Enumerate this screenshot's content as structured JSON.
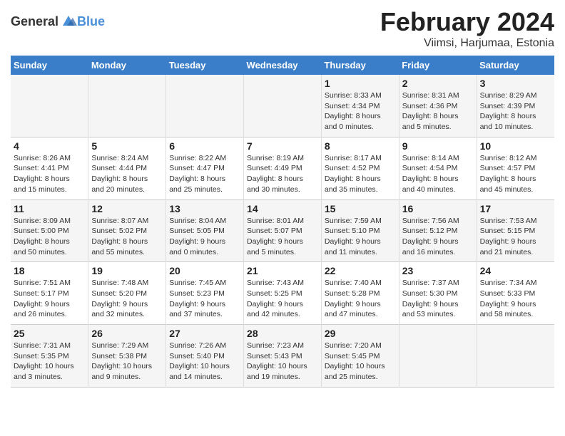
{
  "header": {
    "logo_general": "General",
    "logo_blue": "Blue",
    "title": "February 2024",
    "subtitle": "Viimsi, Harjumaa, Estonia"
  },
  "columns": [
    "Sunday",
    "Monday",
    "Tuesday",
    "Wednesday",
    "Thursday",
    "Friday",
    "Saturday"
  ],
  "weeks": [
    {
      "days": [
        {
          "num": "",
          "info": ""
        },
        {
          "num": "",
          "info": ""
        },
        {
          "num": "",
          "info": ""
        },
        {
          "num": "",
          "info": ""
        },
        {
          "num": "1",
          "info": "Sunrise: 8:33 AM\nSunset: 4:34 PM\nDaylight: 8 hours\nand 0 minutes."
        },
        {
          "num": "2",
          "info": "Sunrise: 8:31 AM\nSunset: 4:36 PM\nDaylight: 8 hours\nand 5 minutes."
        },
        {
          "num": "3",
          "info": "Sunrise: 8:29 AM\nSunset: 4:39 PM\nDaylight: 8 hours\nand 10 minutes."
        }
      ]
    },
    {
      "days": [
        {
          "num": "4",
          "info": "Sunrise: 8:26 AM\nSunset: 4:41 PM\nDaylight: 8 hours\nand 15 minutes."
        },
        {
          "num": "5",
          "info": "Sunrise: 8:24 AM\nSunset: 4:44 PM\nDaylight: 8 hours\nand 20 minutes."
        },
        {
          "num": "6",
          "info": "Sunrise: 8:22 AM\nSunset: 4:47 PM\nDaylight: 8 hours\nand 25 minutes."
        },
        {
          "num": "7",
          "info": "Sunrise: 8:19 AM\nSunset: 4:49 PM\nDaylight: 8 hours\nand 30 minutes."
        },
        {
          "num": "8",
          "info": "Sunrise: 8:17 AM\nSunset: 4:52 PM\nDaylight: 8 hours\nand 35 minutes."
        },
        {
          "num": "9",
          "info": "Sunrise: 8:14 AM\nSunset: 4:54 PM\nDaylight: 8 hours\nand 40 minutes."
        },
        {
          "num": "10",
          "info": "Sunrise: 8:12 AM\nSunset: 4:57 PM\nDaylight: 8 hours\nand 45 minutes."
        }
      ]
    },
    {
      "days": [
        {
          "num": "11",
          "info": "Sunrise: 8:09 AM\nSunset: 5:00 PM\nDaylight: 8 hours\nand 50 minutes."
        },
        {
          "num": "12",
          "info": "Sunrise: 8:07 AM\nSunset: 5:02 PM\nDaylight: 8 hours\nand 55 minutes."
        },
        {
          "num": "13",
          "info": "Sunrise: 8:04 AM\nSunset: 5:05 PM\nDaylight: 9 hours\nand 0 minutes."
        },
        {
          "num": "14",
          "info": "Sunrise: 8:01 AM\nSunset: 5:07 PM\nDaylight: 9 hours\nand 5 minutes."
        },
        {
          "num": "15",
          "info": "Sunrise: 7:59 AM\nSunset: 5:10 PM\nDaylight: 9 hours\nand 11 minutes."
        },
        {
          "num": "16",
          "info": "Sunrise: 7:56 AM\nSunset: 5:12 PM\nDaylight: 9 hours\nand 16 minutes."
        },
        {
          "num": "17",
          "info": "Sunrise: 7:53 AM\nSunset: 5:15 PM\nDaylight: 9 hours\nand 21 minutes."
        }
      ]
    },
    {
      "days": [
        {
          "num": "18",
          "info": "Sunrise: 7:51 AM\nSunset: 5:17 PM\nDaylight: 9 hours\nand 26 minutes."
        },
        {
          "num": "19",
          "info": "Sunrise: 7:48 AM\nSunset: 5:20 PM\nDaylight: 9 hours\nand 32 minutes."
        },
        {
          "num": "20",
          "info": "Sunrise: 7:45 AM\nSunset: 5:23 PM\nDaylight: 9 hours\nand 37 minutes."
        },
        {
          "num": "21",
          "info": "Sunrise: 7:43 AM\nSunset: 5:25 PM\nDaylight: 9 hours\nand 42 minutes."
        },
        {
          "num": "22",
          "info": "Sunrise: 7:40 AM\nSunset: 5:28 PM\nDaylight: 9 hours\nand 47 minutes."
        },
        {
          "num": "23",
          "info": "Sunrise: 7:37 AM\nSunset: 5:30 PM\nDaylight: 9 hours\nand 53 minutes."
        },
        {
          "num": "24",
          "info": "Sunrise: 7:34 AM\nSunset: 5:33 PM\nDaylight: 9 hours\nand 58 minutes."
        }
      ]
    },
    {
      "days": [
        {
          "num": "25",
          "info": "Sunrise: 7:31 AM\nSunset: 5:35 PM\nDaylight: 10 hours\nand 3 minutes."
        },
        {
          "num": "26",
          "info": "Sunrise: 7:29 AM\nSunset: 5:38 PM\nDaylight: 10 hours\nand 9 minutes."
        },
        {
          "num": "27",
          "info": "Sunrise: 7:26 AM\nSunset: 5:40 PM\nDaylight: 10 hours\nand 14 minutes."
        },
        {
          "num": "28",
          "info": "Sunrise: 7:23 AM\nSunset: 5:43 PM\nDaylight: 10 hours\nand 19 minutes."
        },
        {
          "num": "29",
          "info": "Sunrise: 7:20 AM\nSunset: 5:45 PM\nDaylight: 10 hours\nand 25 minutes."
        },
        {
          "num": "",
          "info": ""
        },
        {
          "num": "",
          "info": ""
        }
      ]
    }
  ]
}
